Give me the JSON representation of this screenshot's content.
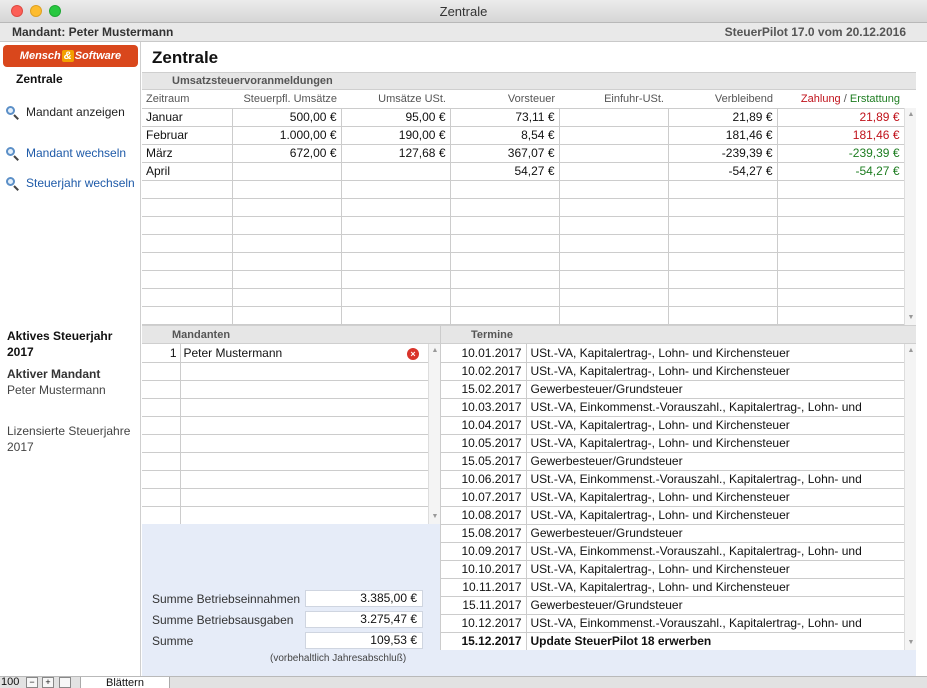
{
  "window": {
    "title": "Zentrale"
  },
  "header": {
    "mandant": "Mandant: Peter Mustermann",
    "version": "SteuerPilot 17.0 vom 20.12.2016"
  },
  "sidebar": {
    "logo_left": "Mensch",
    "logo_amp": "&",
    "logo_right": "Software",
    "section": "Zentrale",
    "links": [
      {
        "label": "Mandant anzeigen",
        "color": "#222222"
      },
      {
        "label": "Mandant wechseln",
        "color": "#1e5aa8"
      },
      {
        "label": "Steuerjahr wechseln",
        "color": "#1e5aa8"
      }
    ],
    "info": {
      "active_year_label": "Aktives Steuerjahr",
      "active_year": "2017",
      "active_client_label": "Aktiver Mandant",
      "active_client": "Peter Mustermann",
      "licensed_label": "Lizensierte Steuerjahre",
      "licensed_years": "2017"
    }
  },
  "main": {
    "title": "Zentrale",
    "ust": {
      "section_title": "Umsatzsteuervoranmeldungen",
      "headers": {
        "zeitraum": "Zeitraum",
        "steuerpfl": "Steuerpfl. Umsätze",
        "umsaetze_ust": "Umsätze USt.",
        "vorsteuer": "Vorsteuer",
        "einfuhr": "Einfuhr-USt.",
        "verbleibend": "Verbleibend",
        "zahlung": "Zahlung",
        "slash": " / ",
        "erstattung": "Erstattung"
      },
      "rows": [
        {
          "zeitraum": "Januar",
          "steuerpfl": "500,00 €",
          "umsaetze_ust": "95,00 €",
          "vorsteuer": "73,11 €",
          "einfuhr": "",
          "verbleibend": "21,89 €",
          "result": "21,89 €",
          "result_type": "zahlung"
        },
        {
          "zeitraum": "Februar",
          "steuerpfl": "1.000,00 €",
          "umsaetze_ust": "190,00 €",
          "vorsteuer": "8,54 €",
          "einfuhr": "",
          "verbleibend": "181,46 €",
          "result": "181,46 €",
          "result_type": "zahlung"
        },
        {
          "zeitraum": "März",
          "steuerpfl": "672,00 €",
          "umsaetze_ust": "127,68 €",
          "vorsteuer": "367,07 €",
          "einfuhr": "",
          "verbleibend": "-239,39 €",
          "result": "-239,39 €",
          "result_type": "erstattung"
        },
        {
          "zeitraum": "April",
          "steuerpfl": "",
          "umsaetze_ust": "",
          "vorsteuer": "54,27 €",
          "einfuhr": "",
          "verbleibend": "-54,27 €",
          "result": "-54,27 €",
          "result_type": "erstattung"
        }
      ]
    },
    "mandanten": {
      "section_title": "Mandanten",
      "rows": [
        {
          "num": "1",
          "name": "Peter Mustermann"
        }
      ]
    },
    "termine": {
      "section_title": "Termine",
      "rows": [
        {
          "date": "10.01.2017",
          "text": "USt.-VA, Kapitalertrag-, Lohn- und Kirchensteuer",
          "bold": false
        },
        {
          "date": "10.02.2017",
          "text": "USt.-VA, Kapitalertrag-, Lohn- und Kirchensteuer",
          "bold": false
        },
        {
          "date": "15.02.2017",
          "text": "Gewerbesteuer/Grundsteuer",
          "bold": false
        },
        {
          "date": "10.03.2017",
          "text": "USt.-VA, Einkommenst.-Vorauszahl., Kapitalertrag-, Lohn- und",
          "bold": false
        },
        {
          "date": "10.04.2017",
          "text": "USt.-VA, Kapitalertrag-, Lohn- und Kirchensteuer",
          "bold": false
        },
        {
          "date": "10.05.2017",
          "text": "USt.-VA, Kapitalertrag-, Lohn- und Kirchensteuer",
          "bold": false
        },
        {
          "date": "15.05.2017",
          "text": "Gewerbesteuer/Grundsteuer",
          "bold": false
        },
        {
          "date": "10.06.2017",
          "text": "USt.-VA, Einkommenst.-Vorauszahl., Kapitalertrag-, Lohn- und",
          "bold": false
        },
        {
          "date": "10.07.2017",
          "text": "USt.-VA, Kapitalertrag-, Lohn- und Kirchensteuer",
          "bold": false
        },
        {
          "date": "10.08.2017",
          "text": "USt.-VA, Kapitalertrag-, Lohn- und Kirchensteuer",
          "bold": false
        },
        {
          "date": "15.08.2017",
          "text": "Gewerbesteuer/Grundsteuer",
          "bold": false
        },
        {
          "date": "10.09.2017",
          "text": "USt.-VA, Einkommenst.-Vorauszahl., Kapitalertrag-, Lohn- und",
          "bold": false
        },
        {
          "date": "10.10.2017",
          "text": "USt.-VA, Kapitalertrag-, Lohn- und Kirchensteuer",
          "bold": false
        },
        {
          "date": "10.11.2017",
          "text": "USt.-VA, Kapitalertrag-, Lohn- und Kirchensteuer",
          "bold": false
        },
        {
          "date": "15.11.2017",
          "text": "Gewerbesteuer/Grundsteuer",
          "bold": false
        },
        {
          "date": "10.12.2017",
          "text": "USt.-VA, Einkommenst.-Vorauszahl., Kapitalertrag-, Lohn- und",
          "bold": false
        },
        {
          "date": "15.12.2017",
          "text": "Update SteuerPilot 18 erwerben",
          "bold": true
        }
      ]
    },
    "summary": {
      "einnahmen_label": "Summe Betriebseinnahmen",
      "einnahmen": "3.385,00 €",
      "ausgaben_label": "Summe Betriebsausgaben",
      "ausgaben": "3.275,47 €",
      "summe_label": "Summe",
      "summe": "109,53 €",
      "note": "(vorbehaltlich Jahresabschluß)"
    }
  },
  "statusbar": {
    "zoom": "100",
    "minus": "−",
    "plus": "+",
    "mode": "Blättern"
  },
  "colors": {
    "zahlung": "#c0121b",
    "erstattung": "#1e7d21",
    "summary_bg": "#e6ecf8"
  },
  "icons": [
    "search-icon",
    "delete-icon",
    "scroll-up-icon",
    "scroll-down-icon",
    "layout-icon"
  ]
}
